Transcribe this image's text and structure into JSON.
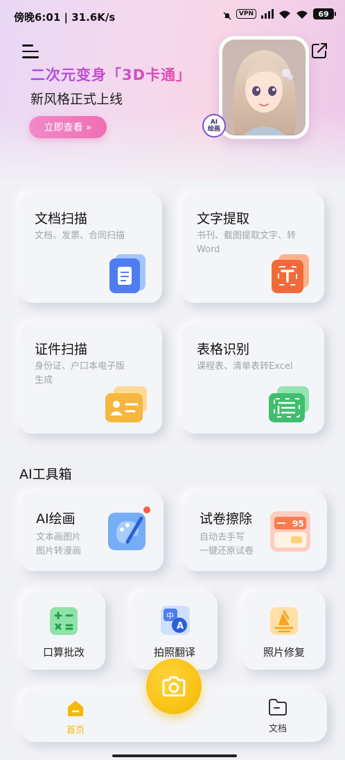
{
  "status_bar": {
    "left_text": "傍晚6:01 | 31.6K/s",
    "vpn": "VPN",
    "battery": "69"
  },
  "banner": {
    "title": "二次元变身「3D卡通」",
    "subtitle": "新风格正式上线",
    "button_label": "立即查看 »",
    "badge_line1": "AI",
    "badge_line2": "绘画"
  },
  "main_cards": [
    {
      "title": "文档扫描",
      "desc": "文档、发票、合同扫描",
      "icon": "document-scan-icon",
      "color": "#4f7cf0"
    },
    {
      "title": "文字提取",
      "desc_line1": "书刊、截图提取文字、转",
      "desc_line2": "Word",
      "icon": "text-extract-icon",
      "color": "#f26a3a"
    },
    {
      "title": "证件扫描",
      "desc_line1": "身份证、户口本电子版",
      "desc_line2": "生成",
      "icon": "id-card-icon",
      "color": "#f5b740"
    },
    {
      "title": "表格识别",
      "desc": "课程表、清单表转Excel",
      "icon": "table-recognize-icon",
      "color": "#3fbf6e"
    }
  ],
  "ai_toolbox": {
    "title": "AI工具箱",
    "cards": [
      {
        "title": "AI绘画",
        "desc_line1": "文本画图片",
        "desc_line2": "图片转漫画",
        "icon": "paint-brush-icon"
      },
      {
        "title": "试卷擦除",
        "desc_line1": "自动去手写",
        "desc_line2": "一键还原试卷",
        "icon": "exam-erase-icon",
        "score": "95"
      }
    ],
    "small_tools": [
      {
        "label": "口算批改",
        "icon": "calculator-icon"
      },
      {
        "label": "拍照翻译",
        "icon": "translate-icon",
        "glyph_a": "中",
        "glyph_b": "A"
      },
      {
        "label": "照片修复",
        "icon": "photo-repair-icon"
      }
    ]
  },
  "bottom_nav": {
    "home_label": "首页",
    "docs_label": "文档",
    "accent": "#f5b800"
  }
}
